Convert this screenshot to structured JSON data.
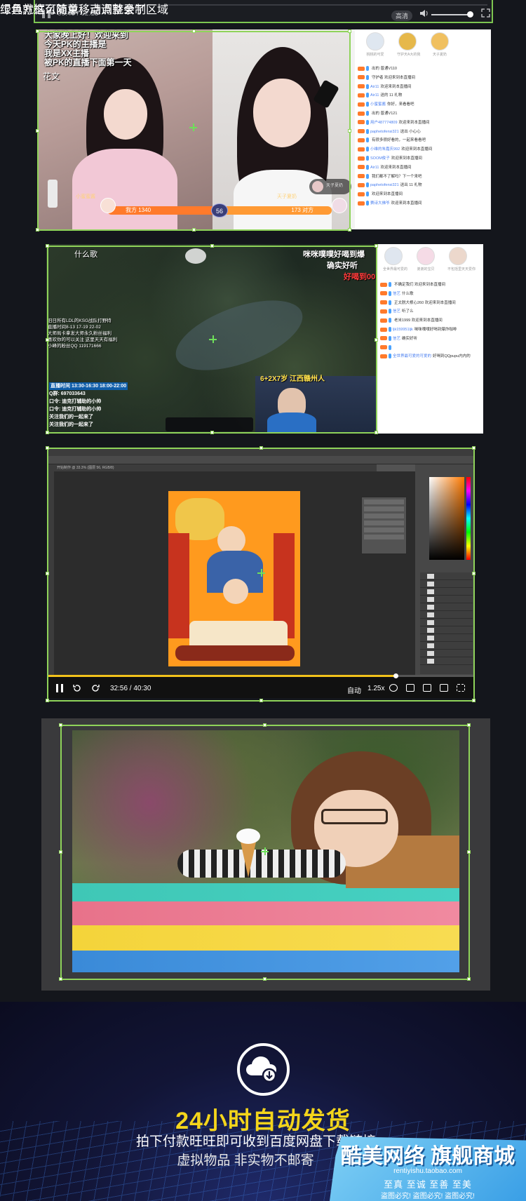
{
  "player_top": {
    "time": "00:49 / 02:15",
    "quality": "高清"
  },
  "panel1": {
    "overlay_lines": [
      "大家晚上好！欢迎来到",
      "今天PK的主播是",
      "我是XX主播",
      "被PK的直播下面第一天"
    ],
    "overlay_side": "花文",
    "host_left": "小蜜蜜酱",
    "host_right": "天子夏奶",
    "pk_left": "我方 1340",
    "pk_mid": "56",
    "pk_right": "173 对方",
    "guest": "天子夏奶",
    "chat_heads": [
      "桃桃的可爱",
      "守护天A大的我",
      "天子夏奶"
    ],
    "chat": [
      {
        "user": "",
        "msg": "出的 普通V110"
      },
      {
        "user": "",
        "msg": "守护者 欢迎来到本直播间"
      },
      {
        "user": "Air11",
        "msg": "欢迎来到本直播间"
      },
      {
        "user": "Air11",
        "msg": "送的 11 礼物"
      },
      {
        "user": "小蜜蜜酱",
        "msg": "你好，来看看吧"
      },
      {
        "user": "",
        "msg": "出的 普通V121"
      },
      {
        "user": "用户487774809",
        "msg": "欢迎来到本直播间"
      },
      {
        "user": "paphetofensi321",
        "msg": "送出 小心心"
      },
      {
        "user": "",
        "msg": "有很多很好看的，一起来看看吧"
      },
      {
        "user": "小维的朱嘉庆992",
        "msg": "欢迎来到本直播间"
      },
      {
        "user": "SOOM俊子",
        "msg": "欢迎来到本直播间"
      },
      {
        "user": "Air11",
        "msg": "欢迎来到本直播间"
      },
      {
        "user": "",
        "msg": "我们都不了解吗？下一个来吧"
      },
      {
        "user": "paphetofensi321",
        "msg": "送出 11 礼物"
      },
      {
        "user": "",
        "msg": "欢迎来到本直播间"
      },
      {
        "user": "赛诗大佛爷",
        "msg": "欢迎来到本直播间"
      }
    ]
  },
  "panel2": {
    "song": "什么歌",
    "text_r1": "咪咪噗噗好喝到爆",
    "text_r2": "确实好听",
    "text_r3": "好喝到00",
    "info_lines": [
      "旧日所有LDL的KSG战队打野特",
      "直播时间8-13 17-19 22-02",
      "大师局卡拿发大师永久粉丝福利",
      "喜欢你的可以关注 这里天天有福利",
      "小峰的粉丝QQ 119171666"
    ],
    "ads": [
      "直播时间 13:30-16:30 18:00-22:00",
      "Q群: 697033643",
      "口令: 迪克打辅助的小帅",
      "口令: 迪克打辅助的小帅",
      "关注我们的一起来了",
      "关注我们的一起来了"
    ],
    "cam_title": "6+2X7岁 江西赣州人",
    "chat_heads": [
      "全世界最可爱的",
      "弟弟的宝贝",
      "不包括里天天爱你"
    ],
    "chat": [
      {
        "user": "",
        "msg": "不确定我们 欢迎来到本直播间"
      },
      {
        "user": "信艺",
        "msg": "什么歌"
      },
      {
        "user": "",
        "msg": "正太脱大根心260 欢迎来到本直播间"
      },
      {
        "user": "信艺",
        "msg": "听了么"
      },
      {
        "user": "",
        "msg": "老米1999 欢迎来到本直播间"
      },
      {
        "user": "ljk159951ljk",
        "msg": "咪咪噗噗好喝到爆炸咖啡"
      },
      {
        "user": "信艺",
        "msg": "确实好听"
      },
      {
        "user": "",
        "msg": ""
      },
      {
        "user": "全世界最可爱的可爱的",
        "msg": "好喝到QQpupu内内的"
      }
    ]
  },
  "panel3": {
    "tab": "开始制作 @ 33.3% (图层 56, RGB/8)",
    "playback_time": "32:56 / 40:30",
    "auto_label": "自动",
    "speed": "1.25x",
    "progress": 0.815
  },
  "panel4": {
    "caption1": "绿色方框可随意移动调整录制区域",
    "caption2": "工具就这么简单，点点就会了"
  },
  "promo": {
    "title": "24小时自动发货",
    "sub1": "拍下付款旺旺即可收到百度网盘下载链接",
    "sub2": "虚拟物品 非实物不邮寄",
    "shop_name": "酷美网络 旗舰商城",
    "shop_url": "rentiyishu.taobao.com",
    "shop_slogan": "至真 至诚   至善 至美",
    "shop_warn": "盗图必究! 盗图必究! 盗图必究!"
  },
  "colors": {
    "frame_green": "#8fd35a",
    "title_yellow": "#f4d51b",
    "progress_yellow": "#f2c21b"
  }
}
